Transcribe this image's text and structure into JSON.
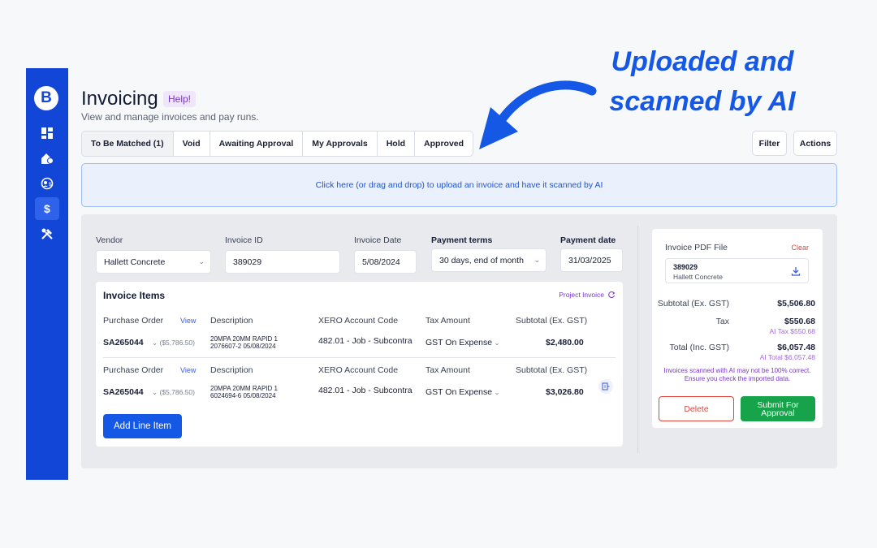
{
  "annotation": {
    "line1": "Uploaded and",
    "line2": "scanned by AI"
  },
  "logo": {
    "letter": "B"
  },
  "sidebar": {
    "items": [
      {
        "icon": "dashboard-icon"
      },
      {
        "icon": "house-dollar-icon"
      },
      {
        "icon": "user-circle-icon"
      },
      {
        "icon": "dollar-icon",
        "active": true
      },
      {
        "icon": "tools-icon"
      }
    ]
  },
  "header": {
    "title": "Invoicing",
    "help": "Help!",
    "subtitle": "View and manage invoices and pay runs."
  },
  "tabs": [
    {
      "label": "To Be Matched (1)",
      "active": true
    },
    {
      "label": "Void"
    },
    {
      "label": "Awaiting Approval"
    },
    {
      "label": "My Approvals"
    },
    {
      "label": "Hold"
    },
    {
      "label": "Approved"
    }
  ],
  "toolbar": {
    "filter": "Filter",
    "actions": "Actions"
  },
  "dropzone": {
    "text": "Click here (or drag and drop) to upload an invoice and have it scanned by AI"
  },
  "form": {
    "vendor_label": "Vendor",
    "vendor_value": "Hallett Concrete",
    "invoice_id_label": "Invoice ID",
    "invoice_id_value": "389029",
    "invoice_date_label": "Invoice Date",
    "invoice_date_value": "5/08/2024",
    "payment_terms_label": "Payment terms",
    "payment_terms_value": "30 days, end of month",
    "payment_date_label": "Payment date",
    "payment_date_value": "31/03/2025"
  },
  "items": {
    "title": "Invoice Items",
    "project_invoice": "Project Invoice",
    "headers": {
      "po": "Purchase Order",
      "view": "View",
      "desc": "Description",
      "xero": "XERO Account Code",
      "tax": "Tax Amount",
      "subtotal": "Subtotal (Ex. GST)"
    },
    "rows": [
      {
        "po": "SA265044",
        "po_amount": "($5,786.50)",
        "desc1": "20MPA 20MM RAPID 1",
        "desc2": "2076607-2 05/08/2024",
        "xero": "482.01 - Job - Subcontra",
        "tax": "GST On Expense",
        "subtotal": "$2,480.00"
      },
      {
        "po": "SA265044",
        "po_amount": "($5,786.50)",
        "desc1": "20MPA 20MM RAPID 1",
        "desc2": "6024694-6 05/08/2024",
        "xero": "482.01 - Job - Subcontra",
        "tax": "GST On Expense",
        "subtotal": "$3,026.80"
      }
    ],
    "add_button": "Add Line Item"
  },
  "pdf": {
    "title": "Invoice PDF File",
    "clear": "Clear",
    "file_id": "389029",
    "file_vendor": "Hallett Concrete"
  },
  "summary": {
    "subtotal_label": "Subtotal (Ex. GST)",
    "subtotal_value": "$5,506.80",
    "tax_label": "Tax",
    "tax_value": "$550.68",
    "ai_tax": "AI Tax  $550.68",
    "total_label": "Total (Inc. GST)",
    "total_value": "$6,057.48",
    "ai_total": "AI Total  $6,057.48",
    "warning": "Invoices scanned with AI may not be 100% correct. Ensure you check the imported data.",
    "delete": "Delete",
    "submit": "Submit For Approval"
  },
  "colors": {
    "brand": "#1246d6",
    "accent": "#1558e6",
    "danger": "#e0443a",
    "success": "#16a34a",
    "ai": "#7a35c8"
  }
}
